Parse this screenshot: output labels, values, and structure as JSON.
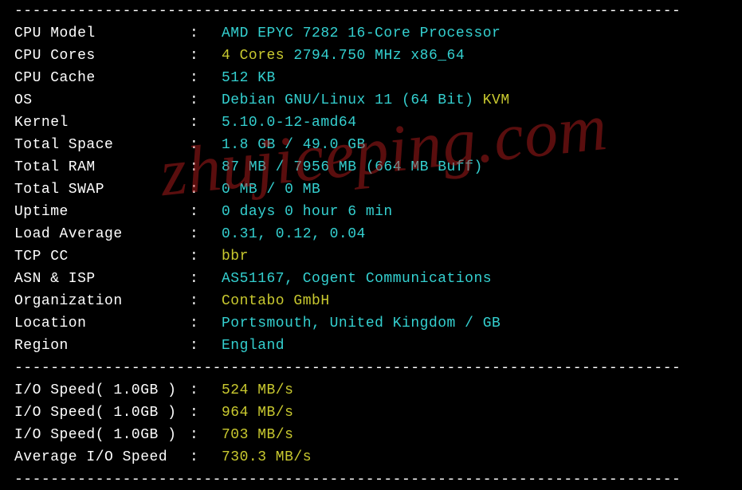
{
  "watermark_text": "zhujiceping.com",
  "sys": [
    {
      "label": "CPU Model",
      "segments": [
        {
          "text": "AMD EPYC 7282 16-Core Processor",
          "color": "cyan"
        }
      ]
    },
    {
      "label": "CPU Cores",
      "segments": [
        {
          "text": "4 Cores",
          "color": "yellow"
        },
        {
          "text": " 2794.750 MHz x86_64",
          "color": "cyan"
        }
      ]
    },
    {
      "label": "CPU Cache",
      "segments": [
        {
          "text": "512 KB",
          "color": "cyan"
        }
      ]
    },
    {
      "label": "OS",
      "segments": [
        {
          "text": "Debian GNU/Linux 11 (64 Bit)",
          "color": "cyan"
        },
        {
          "text": " KVM",
          "color": "yellow"
        }
      ]
    },
    {
      "label": "Kernel",
      "segments": [
        {
          "text": "5.10.0-12-amd64",
          "color": "cyan"
        }
      ]
    },
    {
      "label": "Total Space",
      "segments": [
        {
          "text": "1.8 GB / 49.0 GB",
          "color": "cyan"
        }
      ]
    },
    {
      "label": "Total RAM",
      "segments": [
        {
          "text": "87 MB / 7956 MB (664 MB Buff)",
          "color": "cyan"
        }
      ]
    },
    {
      "label": "Total SWAP",
      "segments": [
        {
          "text": "0 MB / 0 MB",
          "color": "cyan"
        }
      ]
    },
    {
      "label": "Uptime",
      "segments": [
        {
          "text": "0 days 0 hour 6 min",
          "color": "cyan"
        }
      ]
    },
    {
      "label": "Load Average",
      "segments": [
        {
          "text": "0.31, 0.12, 0.04",
          "color": "cyan"
        }
      ]
    },
    {
      "label": "TCP CC",
      "segments": [
        {
          "text": "bbr",
          "color": "yellow"
        }
      ]
    },
    {
      "label": "ASN & ISP",
      "segments": [
        {
          "text": "AS51167, Cogent Communications",
          "color": "cyan"
        }
      ]
    },
    {
      "label": "Organization",
      "segments": [
        {
          "text": "Contabo GmbH",
          "color": "yellow"
        }
      ]
    },
    {
      "label": "Location",
      "segments": [
        {
          "text": "Portsmouth, United Kingdom / GB",
          "color": "cyan"
        }
      ]
    },
    {
      "label": "Region",
      "segments": [
        {
          "text": "England",
          "color": "cyan"
        }
      ]
    }
  ],
  "io": [
    {
      "label": "I/O Speed( 1.0GB )",
      "segments": [
        {
          "text": "524 MB/s",
          "color": "yellow"
        }
      ]
    },
    {
      "label": "I/O Speed( 1.0GB )",
      "segments": [
        {
          "text": "964 MB/s",
          "color": "yellow"
        }
      ]
    },
    {
      "label": "I/O Speed( 1.0GB )",
      "segments": [
        {
          "text": "703 MB/s",
          "color": "yellow"
        }
      ]
    },
    {
      "label": "Average I/O Speed",
      "segments": [
        {
          "text": "730.3 MB/s",
          "color": "yellow"
        }
      ]
    }
  ],
  "divider": "--------------------------------------------------------------------------"
}
